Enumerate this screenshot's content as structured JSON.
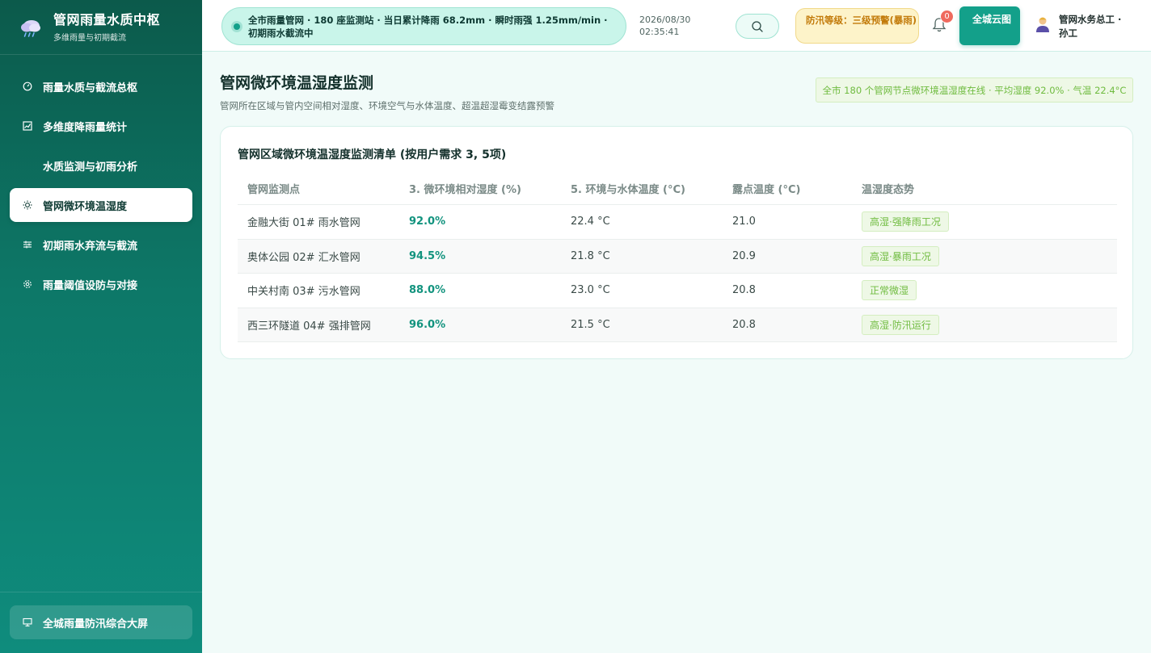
{
  "brand": {
    "title": "管网雨量水质中枢",
    "subtitle": "多维雨量与初期截流"
  },
  "nav": [
    {
      "label": "雨量水质与截流总枢",
      "icon": "gauge-icon"
    },
    {
      "label": "多维度降雨量统计",
      "icon": "chart-icon"
    },
    {
      "label": "水质监测与初雨分析",
      "icon": ""
    },
    {
      "label": "管网微环境温湿度",
      "icon": "sun-icon",
      "active": true
    },
    {
      "label": "初期雨水弃流与截流",
      "icon": "sliders-icon"
    },
    {
      "label": "雨量阈值设防与对接",
      "icon": "gear-icon"
    }
  ],
  "footer_button": "全城雨量防汛综合大屏",
  "header": {
    "ticker": "全市雨量管网 · 180 座监测站 · 当日累计降雨 68.2mm · 瞬时雨强 1.25mm/min · 初期雨水截流中",
    "date": "2026/08/30",
    "time": "02:35:41",
    "alert": "防汛等级：三级预警(暴雨)",
    "notification_count": "0",
    "cloud_button": "全城云图",
    "user": "管网水务总工 · 孙工"
  },
  "page": {
    "title": "管网微环境温湿度监测",
    "subtitle": "管网所在区域与管内空间相对湿度、环境空气与水体温度、超温超湿霉变结露预警",
    "summary": "全市 180 个管网节点微环境温湿度在线 · 平均湿度 92.0% · 气温 22.4°C"
  },
  "table": {
    "title": "管网区域微环境温湿度监测清单 (按用户需求 3, 5项)",
    "headers": [
      "管网监测点",
      "3. 微环境相对湿度 (%)",
      "5. 环境与水体温度 (°C)",
      "露点温度 (°C)",
      "温湿度态势"
    ],
    "rows": [
      {
        "point": "金融大街 01# 雨水管网",
        "humidity": "92.0%",
        "temp": "22.4 °C",
        "dew": "21.0",
        "status": "高湿·强降雨工况"
      },
      {
        "point": "奥体公园 02# 汇水管网",
        "humidity": "94.5%",
        "temp": "21.8 °C",
        "dew": "20.9",
        "status": "高湿·暴雨工况"
      },
      {
        "point": "中关村南 03# 污水管网",
        "humidity": "88.0%",
        "temp": "23.0 °C",
        "dew": "20.8",
        "status": "正常微湿"
      },
      {
        "point": "西三环隧道 04# 强排管网",
        "humidity": "96.0%",
        "temp": "21.5 °C",
        "dew": "20.8",
        "status": "高湿·防汛运行"
      }
    ]
  }
}
